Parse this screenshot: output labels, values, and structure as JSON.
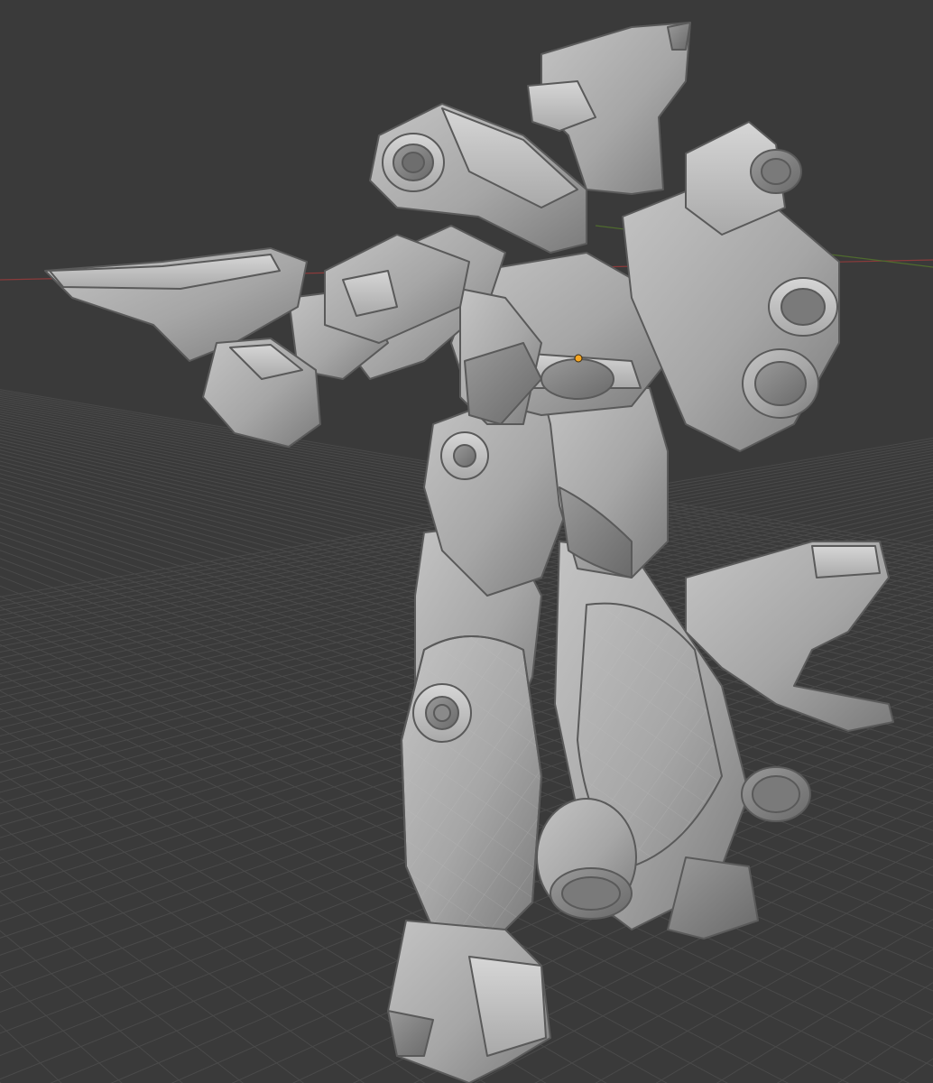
{
  "viewport": {
    "background_color": "#3a3a3a",
    "grid_color": "#4a4a4a",
    "grid_major_color": "#525252",
    "x_axis_color": "#8a3a3a",
    "y_axis_color": "#4f6b2e",
    "origin_marker_color": "#f5a623"
  },
  "model": {
    "shading": "solid",
    "base_color": "#a7a7a7",
    "light_color": "#c9c9c9",
    "dark_color": "#6f6f6f",
    "edge_color": "#555555",
    "wireframe_color": "#b8b8b8"
  }
}
